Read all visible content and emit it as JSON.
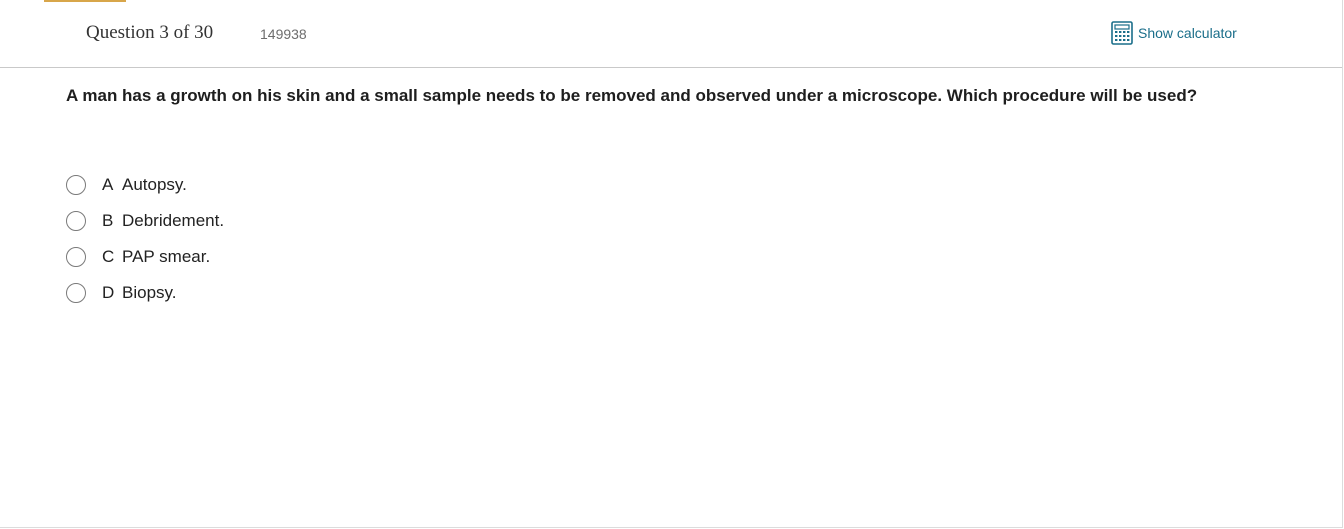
{
  "header": {
    "question_counter": "Question 3 of 30",
    "question_id": "149938",
    "calculator_label": "Show calculator",
    "calculator_icon": "calculator-icon",
    "accent_color": "#d8a64a",
    "link_color": "#1a6e8a"
  },
  "question": {
    "text": "A man has a growth on his skin and a small sample needs to be removed and observed under a microscope.  Which procedure will be used?"
  },
  "options": [
    {
      "letter": "A",
      "text": "Autopsy.",
      "selected": false
    },
    {
      "letter": "B",
      "text": "Debridement.",
      "selected": false
    },
    {
      "letter": "C",
      "text": "PAP smear.",
      "selected": false
    },
    {
      "letter": "D",
      "text": "Biopsy.",
      "selected": false
    }
  ]
}
